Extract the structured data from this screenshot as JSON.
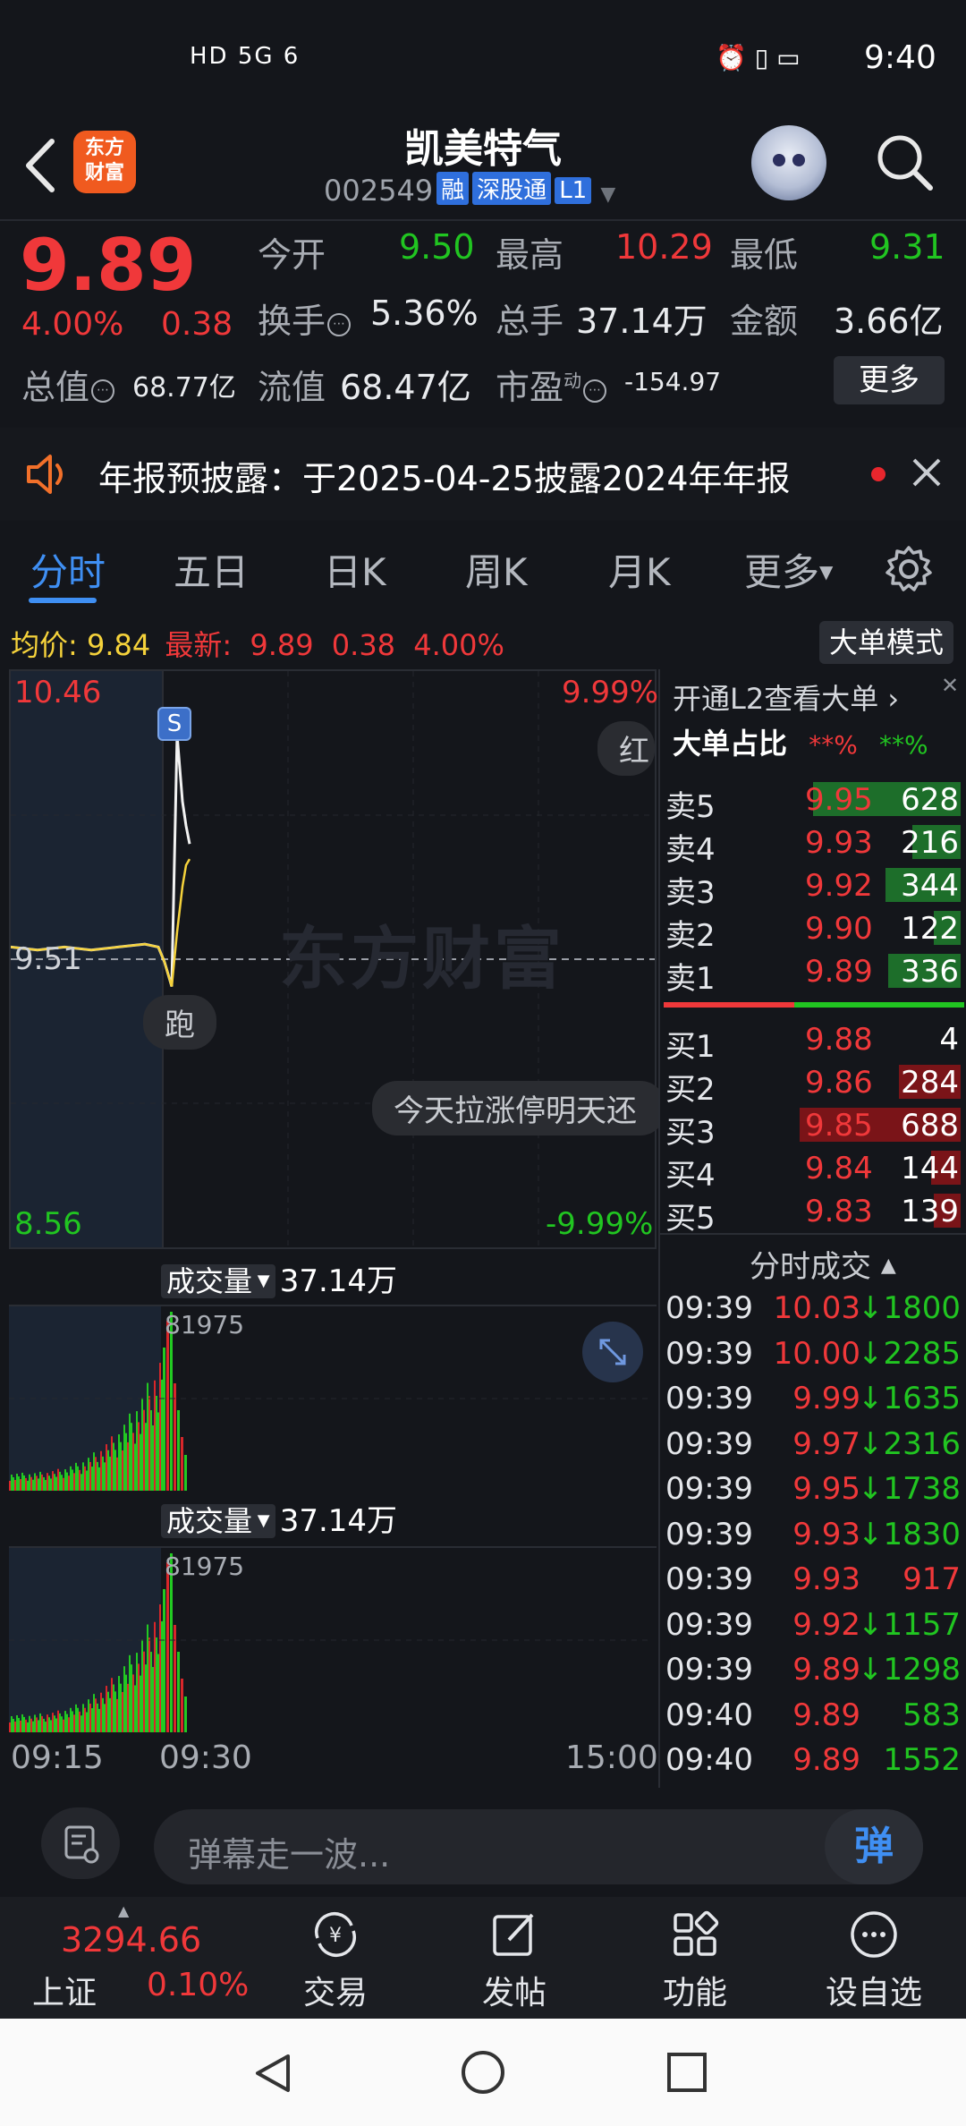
{
  "status_bar": {
    "time": "9:40",
    "left_icons": "HD 5G 6",
    "network": "HD 5G signal wifi"
  },
  "header": {
    "name": "凯美特气",
    "code": "002549",
    "tags": [
      "融",
      "深股通",
      "L1"
    ],
    "logo_text_1": "东方",
    "logo_text_2": "财富"
  },
  "quote": {
    "price": "9.89",
    "change_pct": "4.00%",
    "change_amt": "0.38",
    "open_label": "今开",
    "open": "9.50",
    "high_label": "最高",
    "high": "10.29",
    "low_label": "最低",
    "low": "9.31",
    "turnover_label": "换手",
    "turnover": "5.36%",
    "volume_label": "总手",
    "volume": "37.14万",
    "amount_label": "金额",
    "amount": "3.66亿",
    "mktcap_label": "总值",
    "mktcap": "68.77亿",
    "float_label": "流值",
    "float_cap": "68.47亿",
    "pe_label": "市盈",
    "pe_sup": "动",
    "pe": "-154.97",
    "more": "更多"
  },
  "notice": {
    "text": "年报预披露：于2025-04-25披露2024年年报"
  },
  "tabs": [
    {
      "label": "分时"
    },
    {
      "label": "五日"
    },
    {
      "label": "日K"
    },
    {
      "label": "周K"
    },
    {
      "label": "月K"
    },
    {
      "label": "更多"
    }
  ],
  "chart": {
    "avg_label": "均价:",
    "avg": "9.84",
    "latest_label": "最新:",
    "latest": "9.89",
    "latest_chg": "0.38",
    "latest_pct": "4.00%",
    "big_order_mode": "大单模式",
    "y_max": "10.46",
    "y_ref": "9.51",
    "y_min": "8.56",
    "pct_max": "9.99%",
    "pct_min": "-9.99%",
    "watermark": "东方财富",
    "marker_s": "S",
    "bubble_run": "跑",
    "bubble_hong": "红",
    "bubble_msg": "今天拉涨停明天还",
    "vol_label": "成交量",
    "vol_total": "37.14万",
    "vol_peak": "81975",
    "time_start": "09:15",
    "time_open": "09:30",
    "time_end": "15:00"
  },
  "chart_data": {
    "type": "line",
    "ylim": [
      8.56,
      10.46
    ],
    "reference": 9.51,
    "series": [
      {
        "values": [
          9.55,
          9.54,
          9.55,
          9.54,
          9.55,
          9.56,
          9.55,
          9.5,
          9.42,
          10.25,
          10.03,
          9.95,
          9.89
        ]
      },
      {
        "values": [
          9.55,
          9.54,
          9.55,
          9.54,
          9.55,
          9.56,
          9.55,
          9.5,
          9.42,
          9.6,
          9.75,
          9.82,
          9.84
        ]
      }
    ]
  },
  "order_book": {
    "l2_link": "开通L2查看大单",
    "big_ratio_label": "大单占比",
    "red_mask": "**%",
    "green_mask": "**%",
    "asks": [
      {
        "label": "卖5",
        "price": "9.95",
        "qty": "628",
        "w": 0.55
      },
      {
        "label": "卖4",
        "price": "9.93",
        "qty": "216",
        "w": 0.18
      },
      {
        "label": "卖3",
        "price": "9.92",
        "qty": "344",
        "w": 0.28
      },
      {
        "label": "卖2",
        "price": "9.90",
        "qty": "122",
        "w": 0.1
      },
      {
        "label": "卖1",
        "price": "9.89",
        "qty": "336",
        "w": 0.27
      }
    ],
    "bids": [
      {
        "label": "买1",
        "price": "9.88",
        "qty": "4",
        "w": 0.0
      },
      {
        "label": "买2",
        "price": "9.86",
        "qty": "284",
        "w": 0.23
      },
      {
        "label": "买3",
        "price": "9.85",
        "qty": "688",
        "w": 0.6
      },
      {
        "label": "买4",
        "price": "9.84",
        "qty": "144",
        "w": 0.11
      },
      {
        "label": "买5",
        "price": "9.83",
        "qty": "139",
        "w": 0.1
      }
    ],
    "trades_title": "分时成交",
    "trades": [
      {
        "time": "09:39",
        "price": "10.03",
        "vol": "↓1800",
        "dir": "down"
      },
      {
        "time": "09:39",
        "price": "10.00",
        "vol": "↓2285",
        "dir": "down"
      },
      {
        "time": "09:39",
        "price": "9.99",
        "vol": "↓1635",
        "dir": "down"
      },
      {
        "time": "09:39",
        "price": "9.97",
        "vol": "↓2316",
        "dir": "down"
      },
      {
        "time": "09:39",
        "price": "9.95",
        "vol": "↓1738",
        "dir": "down"
      },
      {
        "time": "09:39",
        "price": "9.93",
        "vol": "↓1830",
        "dir": "down"
      },
      {
        "time": "09:39",
        "price": "9.93",
        "vol": "917",
        "dir": "up"
      },
      {
        "time": "09:39",
        "price": "9.92",
        "vol": "↓1157",
        "dir": "down"
      },
      {
        "time": "09:39",
        "price": "9.89",
        "vol": "↓1298",
        "dir": "down"
      },
      {
        "time": "09:40",
        "price": "9.89",
        "vol": "583",
        "dir": "down"
      },
      {
        "time": "09:40",
        "price": "9.89",
        "vol": "1552",
        "dir": "down"
      }
    ]
  },
  "danmu": {
    "placeholder": "弹幕走一波...",
    "send": "弹"
  },
  "bottom_nav": {
    "index_value": "3294.66",
    "index_name": "上证",
    "index_pct": "0.10%",
    "items": [
      {
        "label": "交易",
        "icon": "yuan-refresh-icon"
      },
      {
        "label": "发帖",
        "icon": "edit-icon"
      },
      {
        "label": "功能",
        "icon": "grid-icon"
      },
      {
        "label": "设自选",
        "icon": "more-circle-icon"
      }
    ]
  },
  "colors": {
    "up": "#f0383a",
    "down": "#21c521",
    "accent": "#3f8ff3",
    "background": "#14161b"
  }
}
